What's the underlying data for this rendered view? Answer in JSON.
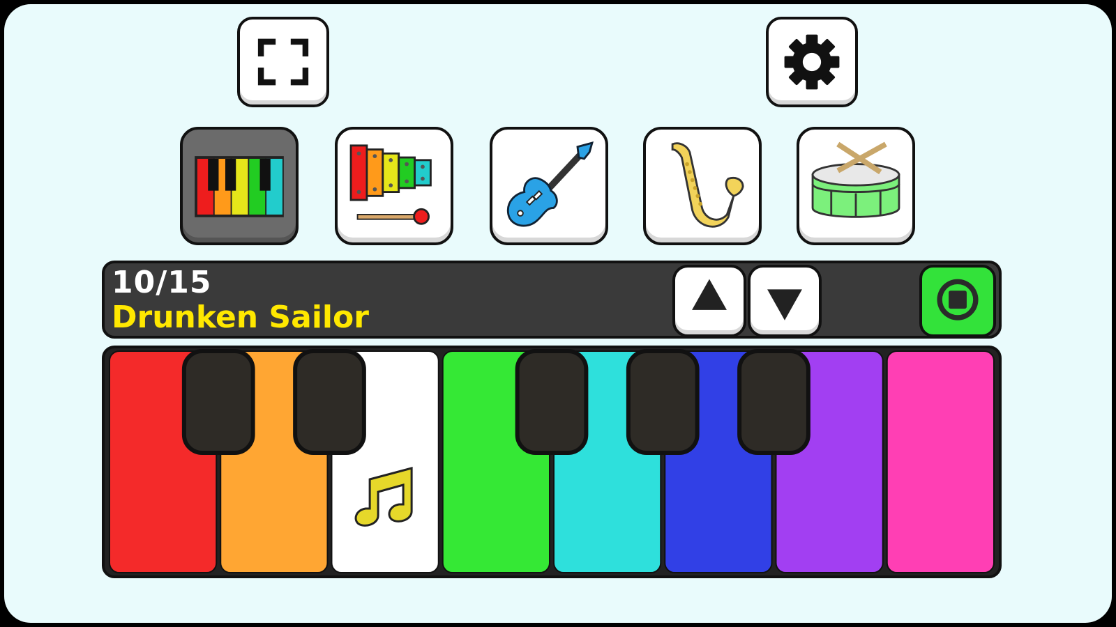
{
  "colors": {
    "background": "#e9fbfc",
    "bar_background": "#3a3a3a",
    "title_color": "#ffe800",
    "stop_button": "#33e23a",
    "selected_instrument_bg": "#6b6b6b"
  },
  "toolbar": {
    "fullscreen_icon": "fullscreen-icon",
    "settings_icon": "gear-icon"
  },
  "instruments": [
    {
      "icon": "piano-icon",
      "selected": true
    },
    {
      "icon": "xylophone-icon",
      "selected": false
    },
    {
      "icon": "electric-guitar-icon",
      "selected": false
    },
    {
      "icon": "saxophone-icon",
      "selected": false
    },
    {
      "icon": "drum-icon",
      "selected": false
    }
  ],
  "song": {
    "counter": "10/15",
    "title": "Drunken Sailor",
    "up_icon": "triangle-up-icon",
    "down_icon": "triangle-down-icon",
    "stop_icon": "stop-icon"
  },
  "keyboard": {
    "white_keys": [
      "#f42a2a",
      "#ffa633",
      "#ffffff",
      "#35e835",
      "#2ee0dc",
      "#3140e6",
      "#a23ff2",
      "#ff3fb4"
    ],
    "black_key_count": 5,
    "highlighted_key_index": 2,
    "highlight_icon": "music-note-icon"
  }
}
